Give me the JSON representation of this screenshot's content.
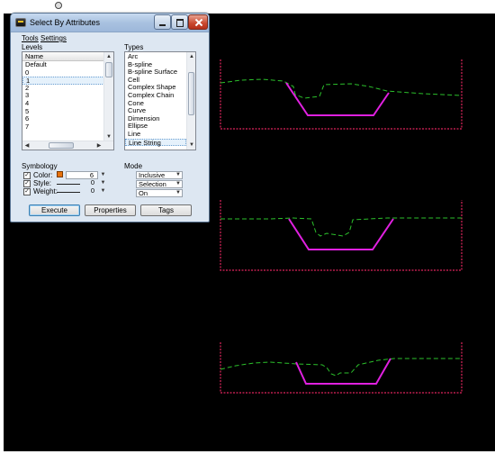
{
  "dialog": {
    "title": "Select By Attributes",
    "menu": {
      "tools": "Tools",
      "settings": "Settings"
    },
    "levels": {
      "label": "Levels",
      "column_header": "Name",
      "items": [
        "Default",
        "0",
        "1",
        "2",
        "3",
        "4",
        "5",
        "6",
        "7"
      ],
      "selected_index": 2
    },
    "types": {
      "label": "Types",
      "items": [
        "Arc",
        "B-spline",
        "B-spline Surface",
        "Cell",
        "Complex Shape",
        "Complex Chain",
        "Cone",
        "Curve",
        "Dimension",
        "Ellipse",
        "Line",
        "Line String"
      ],
      "selected_index": 11
    },
    "symbology": {
      "label": "Symbology",
      "color_label": "Color:",
      "color_value": "6",
      "color_swatch": "#e8720c",
      "style_label": "Style:",
      "style_value": "0",
      "weight_label": "Weight:",
      "weight_value": "0"
    },
    "mode": {
      "label": "Mode",
      "values": [
        "Inclusive",
        "Selection",
        "On"
      ]
    },
    "buttons": {
      "execute": "Execute",
      "properties": "Properties",
      "tags": "Tags"
    }
  },
  "colors": {
    "canvas": "#000000",
    "boundary": "#e0245e",
    "ground_line": "#2bbf2b",
    "channel_line": "#e020e0",
    "dialog_bg": "#dde7f2"
  }
}
